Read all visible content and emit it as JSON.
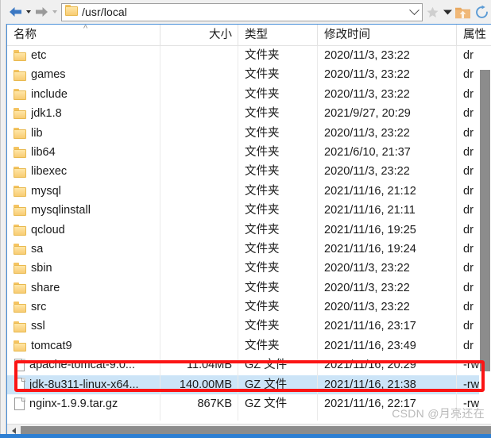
{
  "toolbar": {
    "back_label": "back",
    "back_dropdown_label": "back-history",
    "forward_label": "forward",
    "forward_dropdown_label": "forward-history",
    "path": "/usr/local",
    "path_dropdown_label": "path-history",
    "favorites_label": "favorites",
    "favorites_dropdown_label": "favorites-menu",
    "upload_label": "upload",
    "refresh_label": "refresh"
  },
  "columns": {
    "name": "名称",
    "size": "大小",
    "type": "类型",
    "date": "修改时间",
    "attr": "属性",
    "sort_caret": "^"
  },
  "types": {
    "folder": "文件夹",
    "gz": "GZ 文件"
  },
  "attrs": {
    "dir": "dr",
    "file": "-rw"
  },
  "rows": [
    {
      "name": "etc",
      "icon": "folder-icon",
      "size": "",
      "type": "文件夹",
      "date": "2020/11/3, 23:22",
      "attr": "dr",
      "selected": false
    },
    {
      "name": "games",
      "icon": "folder-icon",
      "size": "",
      "type": "文件夹",
      "date": "2020/11/3, 23:22",
      "attr": "dr",
      "selected": false
    },
    {
      "name": "include",
      "icon": "folder-icon",
      "size": "",
      "type": "文件夹",
      "date": "2020/11/3, 23:22",
      "attr": "dr",
      "selected": false
    },
    {
      "name": "jdk1.8",
      "icon": "folder-icon",
      "size": "",
      "type": "文件夹",
      "date": "2021/9/27, 20:29",
      "attr": "dr",
      "selected": false
    },
    {
      "name": "lib",
      "icon": "folder-icon",
      "size": "",
      "type": "文件夹",
      "date": "2020/11/3, 23:22",
      "attr": "dr",
      "selected": false
    },
    {
      "name": "lib64",
      "icon": "folder-icon",
      "size": "",
      "type": "文件夹",
      "date": "2021/6/10, 21:37",
      "attr": "dr",
      "selected": false
    },
    {
      "name": "libexec",
      "icon": "folder-icon",
      "size": "",
      "type": "文件夹",
      "date": "2020/11/3, 23:22",
      "attr": "dr",
      "selected": false
    },
    {
      "name": "mysql",
      "icon": "folder-icon",
      "size": "",
      "type": "文件夹",
      "date": "2021/11/16, 21:12",
      "attr": "dr",
      "selected": false
    },
    {
      "name": "mysqlinstall",
      "icon": "folder-icon",
      "size": "",
      "type": "文件夹",
      "date": "2021/11/16, 21:11",
      "attr": "dr",
      "selected": false
    },
    {
      "name": "qcloud",
      "icon": "folder-icon",
      "size": "",
      "type": "文件夹",
      "date": "2021/11/16, 19:25",
      "attr": "dr",
      "selected": false
    },
    {
      "name": "sa",
      "icon": "folder-icon",
      "size": "",
      "type": "文件夹",
      "date": "2021/11/16, 19:24",
      "attr": "dr",
      "selected": false
    },
    {
      "name": "sbin",
      "icon": "folder-icon",
      "size": "",
      "type": "文件夹",
      "date": "2020/11/3, 23:22",
      "attr": "dr",
      "selected": false
    },
    {
      "name": "share",
      "icon": "folder-icon",
      "size": "",
      "type": "文件夹",
      "date": "2020/11/3, 23:22",
      "attr": "dr",
      "selected": false
    },
    {
      "name": "src",
      "icon": "folder-icon",
      "size": "",
      "type": "文件夹",
      "date": "2020/11/3, 23:22",
      "attr": "dr",
      "selected": false
    },
    {
      "name": "ssl",
      "icon": "folder-icon",
      "size": "",
      "type": "文件夹",
      "date": "2021/11/16, 23:17",
      "attr": "dr",
      "selected": false
    },
    {
      "name": "tomcat9",
      "icon": "folder-icon",
      "size": "",
      "type": "文件夹",
      "date": "2021/11/16, 23:49",
      "attr": "dr",
      "selected": false
    },
    {
      "name": "apache-tomcat-9.0...",
      "icon": "file-icon",
      "size": "11.04MB",
      "type": "GZ 文件",
      "date": "2021/11/16, 20:29",
      "attr": "-rw",
      "selected": false
    },
    {
      "name": "jdk-8u311-linux-x64...",
      "icon": "file-icon",
      "size": "140.00MB",
      "type": "GZ 文件",
      "date": "2021/11/16, 21:38",
      "attr": "-rw",
      "selected": true
    },
    {
      "name": "nginx-1.9.9.tar.gz",
      "icon": "file-icon",
      "size": "867KB",
      "type": "GZ 文件",
      "date": "2021/11/16, 22:17",
      "attr": "-rw",
      "selected": false
    }
  ],
  "annotation": {
    "highlight_label": "selected-file-highlight"
  },
  "watermark": {
    "text": "CSDN @月亮还在"
  },
  "scrollbars": {
    "vertical_label": "vertical-scrollbar",
    "horizontal_label": "horizontal-scrollbar"
  },
  "colors": {
    "selection": "#cce4f7",
    "annotation": "#fb1414",
    "panel_border": "#4a90d9",
    "folder": "#fcd98b"
  }
}
